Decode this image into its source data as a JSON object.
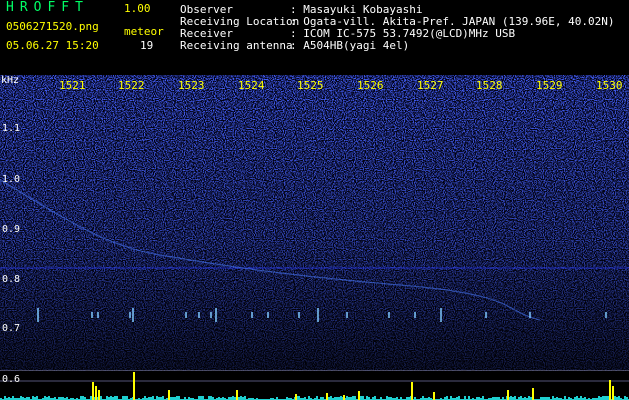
{
  "app": {
    "title": "HROFFT",
    "version": "1.00"
  },
  "file": {
    "name": "0506271520.png",
    "datetime": "05.06.27 15:20"
  },
  "meteor": {
    "label": "meteor",
    "count": "19"
  },
  "info": [
    {
      "label": "Observer",
      "value": ": Masayuki Kobayashi"
    },
    {
      "label": "Receiving Location",
      "value": ": Ogata-vill. Akita-Pref. JAPAN (139.96E, 40.02N)"
    },
    {
      "label": "Receiver",
      "value": ": ICOM IC-575 53.7492(@LCD)MHz USB"
    },
    {
      "label": "Receiving antenna",
      "value": ": A504HB(yagi 4el)"
    }
  ],
  "axis": {
    "y_unit": "kHz",
    "y_ticks": [
      "1.1",
      "1.0",
      "0.9",
      "0.8",
      "0.7",
      "0.6"
    ],
    "x_ticks": [
      "1521",
      "1522",
      "1523",
      "1524",
      "1525",
      "1526",
      "1527",
      "1528",
      "1529",
      "1530"
    ]
  },
  "colors": {
    "background": "#000010",
    "noise": "#1a2bd8",
    "echo": "#7fc8ff",
    "histogram": "#ffff00",
    "header_text": "#ffffff",
    "accent_text": "#ffff00"
  }
}
